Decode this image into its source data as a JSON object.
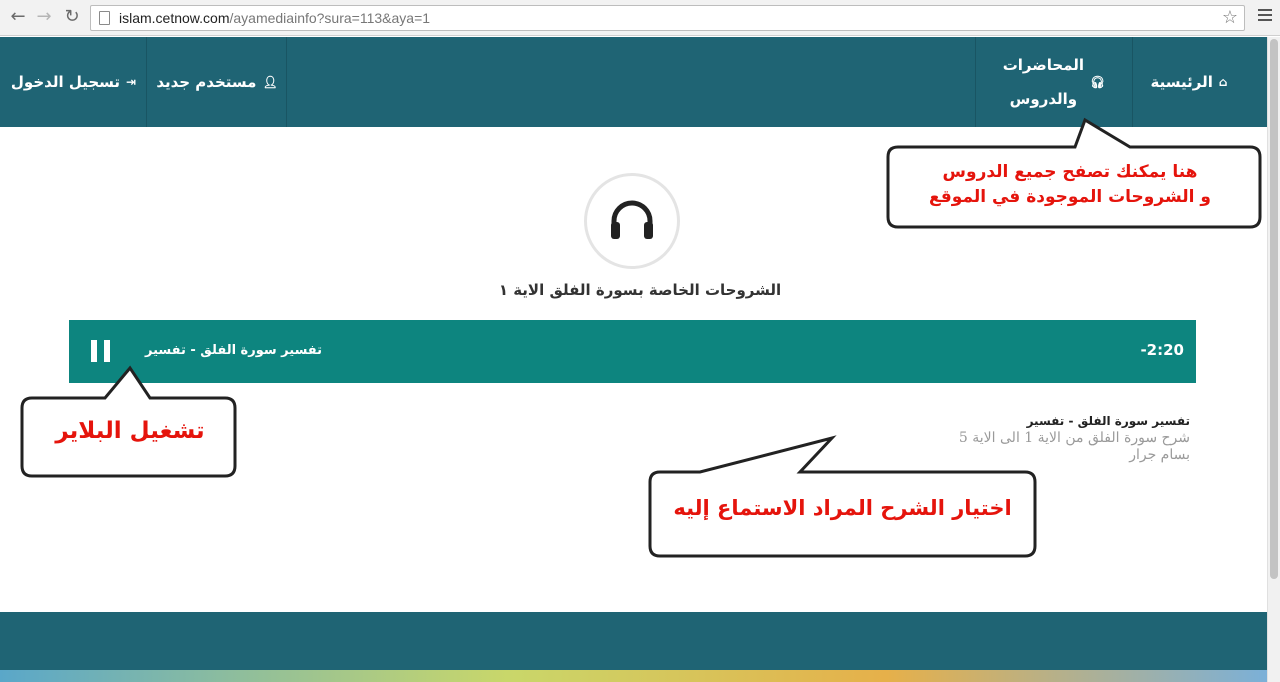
{
  "browser": {
    "url_host": "islam.cetnow.com",
    "url_path": "/ayamediainfo?sura=113&aya=1"
  },
  "nav": {
    "home": "الرئيسية",
    "lectures_line1": "المحاضرات",
    "lectures_line2": "والدروس",
    "new_user": "مستخدم جديد",
    "login": "تسجيل الدخول"
  },
  "main": {
    "title": "الشروحات الخاصة بسورة الفلق الاية ١",
    "player": {
      "track_title": "تفسير سورة الفلق - تفسير",
      "time": "-2:20"
    },
    "lectures": [
      {
        "title": "تفسير سورة الفلق - تفسير",
        "description": "شرح سورة الفلق من الاية 1 الى الاية 5",
        "author": "بسام جرار"
      }
    ]
  },
  "callouts": {
    "browse": {
      "line1": "هنا يمكنك تصفح جميع الدروس",
      "line2": "و الشروحات الموجودة في الموقع"
    },
    "player": "تشغيل البلاير",
    "choose": "اختيار الشرح المراد الاستماع إليه"
  },
  "colors": {
    "header": "#1f6474",
    "player": "#0d857f",
    "callout_text": "#e5140c"
  }
}
